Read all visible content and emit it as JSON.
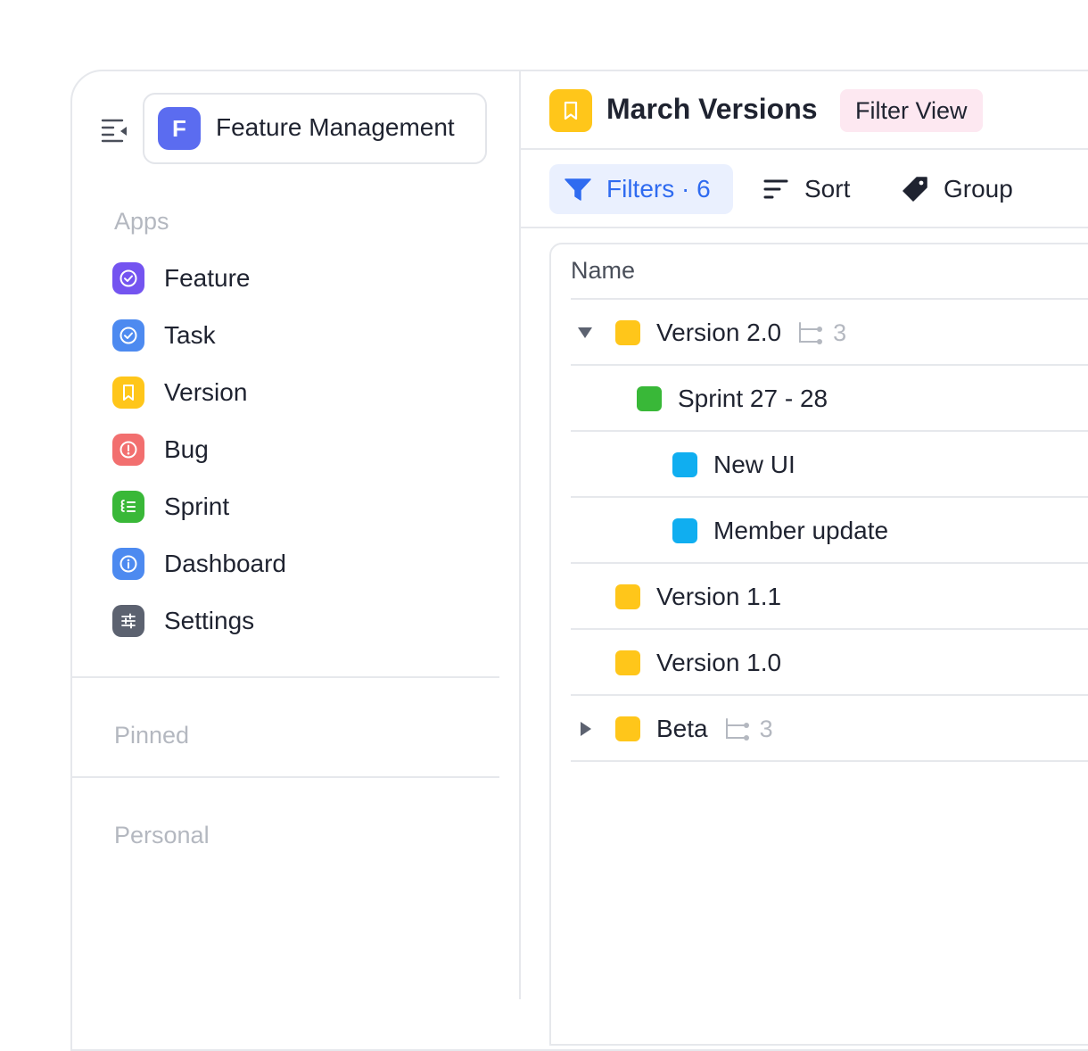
{
  "workspace": {
    "initial": "F",
    "name": "Feature Management"
  },
  "sections": {
    "apps": "Apps",
    "pinned": "Pinned",
    "personal": "Personal"
  },
  "apps": [
    {
      "label": "Feature",
      "icon": "check-circle-icon",
      "color": "#7454f0"
    },
    {
      "label": "Task",
      "icon": "check-circle-icon",
      "color": "#4d8af0"
    },
    {
      "label": "Version",
      "icon": "bookmark-icon",
      "color": "#ffc61a"
    },
    {
      "label": "Bug",
      "icon": "alert-circle-icon",
      "color": "#f26f6f"
    },
    {
      "label": "Sprint",
      "icon": "list-icon",
      "color": "#39b838"
    },
    {
      "label": "Dashboard",
      "icon": "info-circle-icon",
      "color": "#4d8af0"
    },
    {
      "label": "Settings",
      "icon": "sliders-icon",
      "color": "#5c6270"
    }
  ],
  "view": {
    "title": "March Versions",
    "badge": "Filter View",
    "icon_color": "#ffc61a"
  },
  "toolbar": {
    "filters": "Filters · 6",
    "sort": "Sort",
    "group": "Group"
  },
  "table": {
    "column": "Name",
    "rows": [
      {
        "label": "Version 2.0",
        "color": "#ffc61a",
        "expanded": true,
        "subitems": "3"
      },
      {
        "label": "Sprint 27 - 28",
        "color": "#39b838"
      },
      {
        "label": "New UI",
        "color": "#10aef0"
      },
      {
        "label": "Member update",
        "color": "#10aef0"
      },
      {
        "label": "Version 1.1",
        "color": "#ffc61a"
      },
      {
        "label": "Version 1.0",
        "color": "#ffc61a"
      },
      {
        "label": "Beta",
        "color": "#ffc61a",
        "expanded": false,
        "subitems": "3"
      }
    ]
  },
  "colors": {
    "accent": "#2f6bf0",
    "border": "#e6e8ec",
    "muted": "#b4b8c0"
  }
}
